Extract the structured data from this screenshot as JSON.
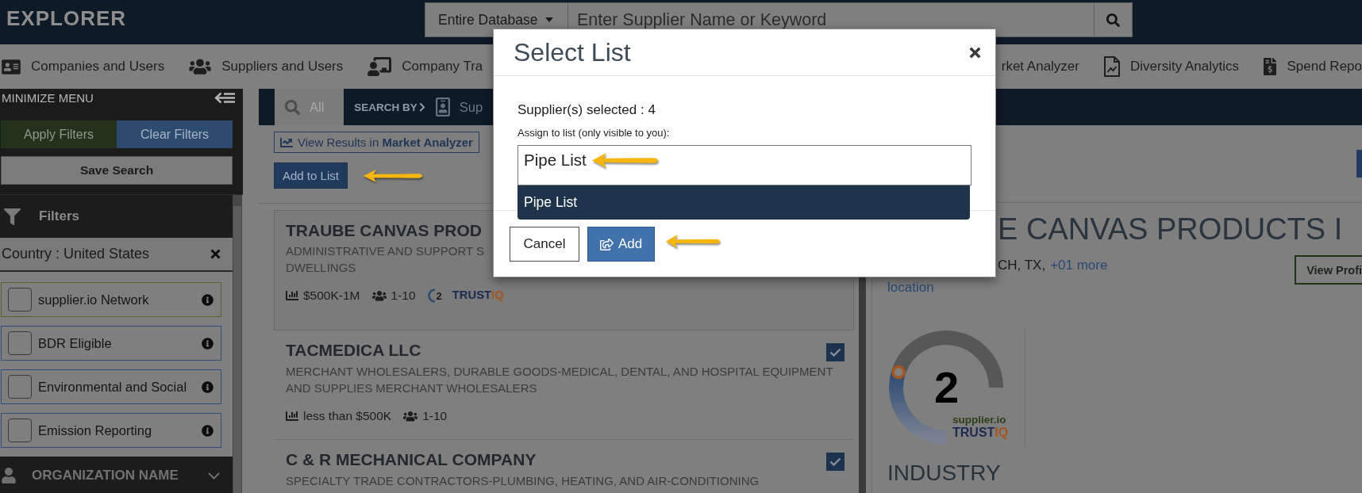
{
  "header": {
    "logo": "EXPLORER",
    "scope": "Entire Database",
    "search": {
      "placeholder": "Enter Supplier Name or Keyword"
    }
  },
  "nav": {
    "items": [
      {
        "label": "Companies and Users"
      },
      {
        "label": "Suppliers and Users"
      },
      {
        "label": "Company Tra"
      },
      {
        "label": "rket Analyzer"
      },
      {
        "label": "Diversity Analytics"
      },
      {
        "label": "Spend Repo"
      }
    ]
  },
  "sidebar": {
    "minimize_label": "MINIMIZE MENU",
    "apply_button": "Apply Filters",
    "clear_button": "Clear Filters",
    "save_button": "Save Search",
    "filters_title": "Filters",
    "active_filter": "Country : United States",
    "filter_options": [
      {
        "label": "supplier.io Network",
        "checked": false,
        "color": "#56652a"
      },
      {
        "label": "BDR Eligible",
        "checked": false,
        "color": "#2d4c7c"
      },
      {
        "label": "Environmental and Social",
        "checked": false,
        "color": "#2d4c7c"
      },
      {
        "label": "Emission Reporting",
        "checked": false,
        "color": "#2d4c7c"
      }
    ],
    "section_title": "ORGANIZATION NAME"
  },
  "tabs": {
    "items": [
      {
        "label": "All",
        "selected": true
      },
      {
        "label": "Sup",
        "selected": false
      }
    ],
    "search_by_label": "SEARCH BY"
  },
  "results": {
    "market_button": "View Results in **Market Analyzer**",
    "add_button": "Add to List",
    "cards": [
      {
        "title": "TRAUBE CANVAS PROD",
        "selected": true,
        "description_lines": [
          "ADMINISTRATIVE AND SUPPORT S",
          "DWELLINGS"
        ],
        "revenue": "$500K-1M",
        "employees": "1-10",
        "trust_score": "2",
        "trust_brand": {
          "main": "TRUST",
          "accent": "IQ"
        }
      },
      {
        "title": "TACMEDICA LLC",
        "selected": false,
        "checked": true,
        "description_lines": [
          "MERCHANT WHOLESALERS, DURABLE GOODS-MEDICAL, DENTAL, AND HOSPITAL EQUIPMENT",
          "AND SUPPLIES MERCHANT WHOLESALERS"
        ],
        "revenue": "less than $500K",
        "employees": "1-10"
      },
      {
        "title": "C & R MECHANICAL COMPANY",
        "selected": false,
        "checked": true,
        "description_lines": [
          "SPECIALTY TRADE CONTRACTORS-PLUMBING, HEATING, AND AIR-CONDITIONING"
        ]
      }
    ]
  },
  "detail": {
    "title": "E CANVAS PRODUCTS I",
    "location": "CH, TX,",
    "more_link": "+01 more",
    "location_link": "location",
    "profile_button": "View Profi",
    "trust_score": "2",
    "trust_provider": "supplier.io",
    "trust_brand": {
      "main": "TRUST",
      "accent": "IQ"
    },
    "industry_heading": "INDUSTRY"
  },
  "modal": {
    "title": "Select List",
    "selected_count": "Supplier(s) selected : 4",
    "list_label": "Assign to list (only visible to you):",
    "list_field": {
      "value": "Pipe List",
      "options": [
        {
          "label": "Pipe List",
          "selected": true
        }
      ]
    },
    "cancel_button": "Cancel",
    "add_button": "Add"
  }
}
